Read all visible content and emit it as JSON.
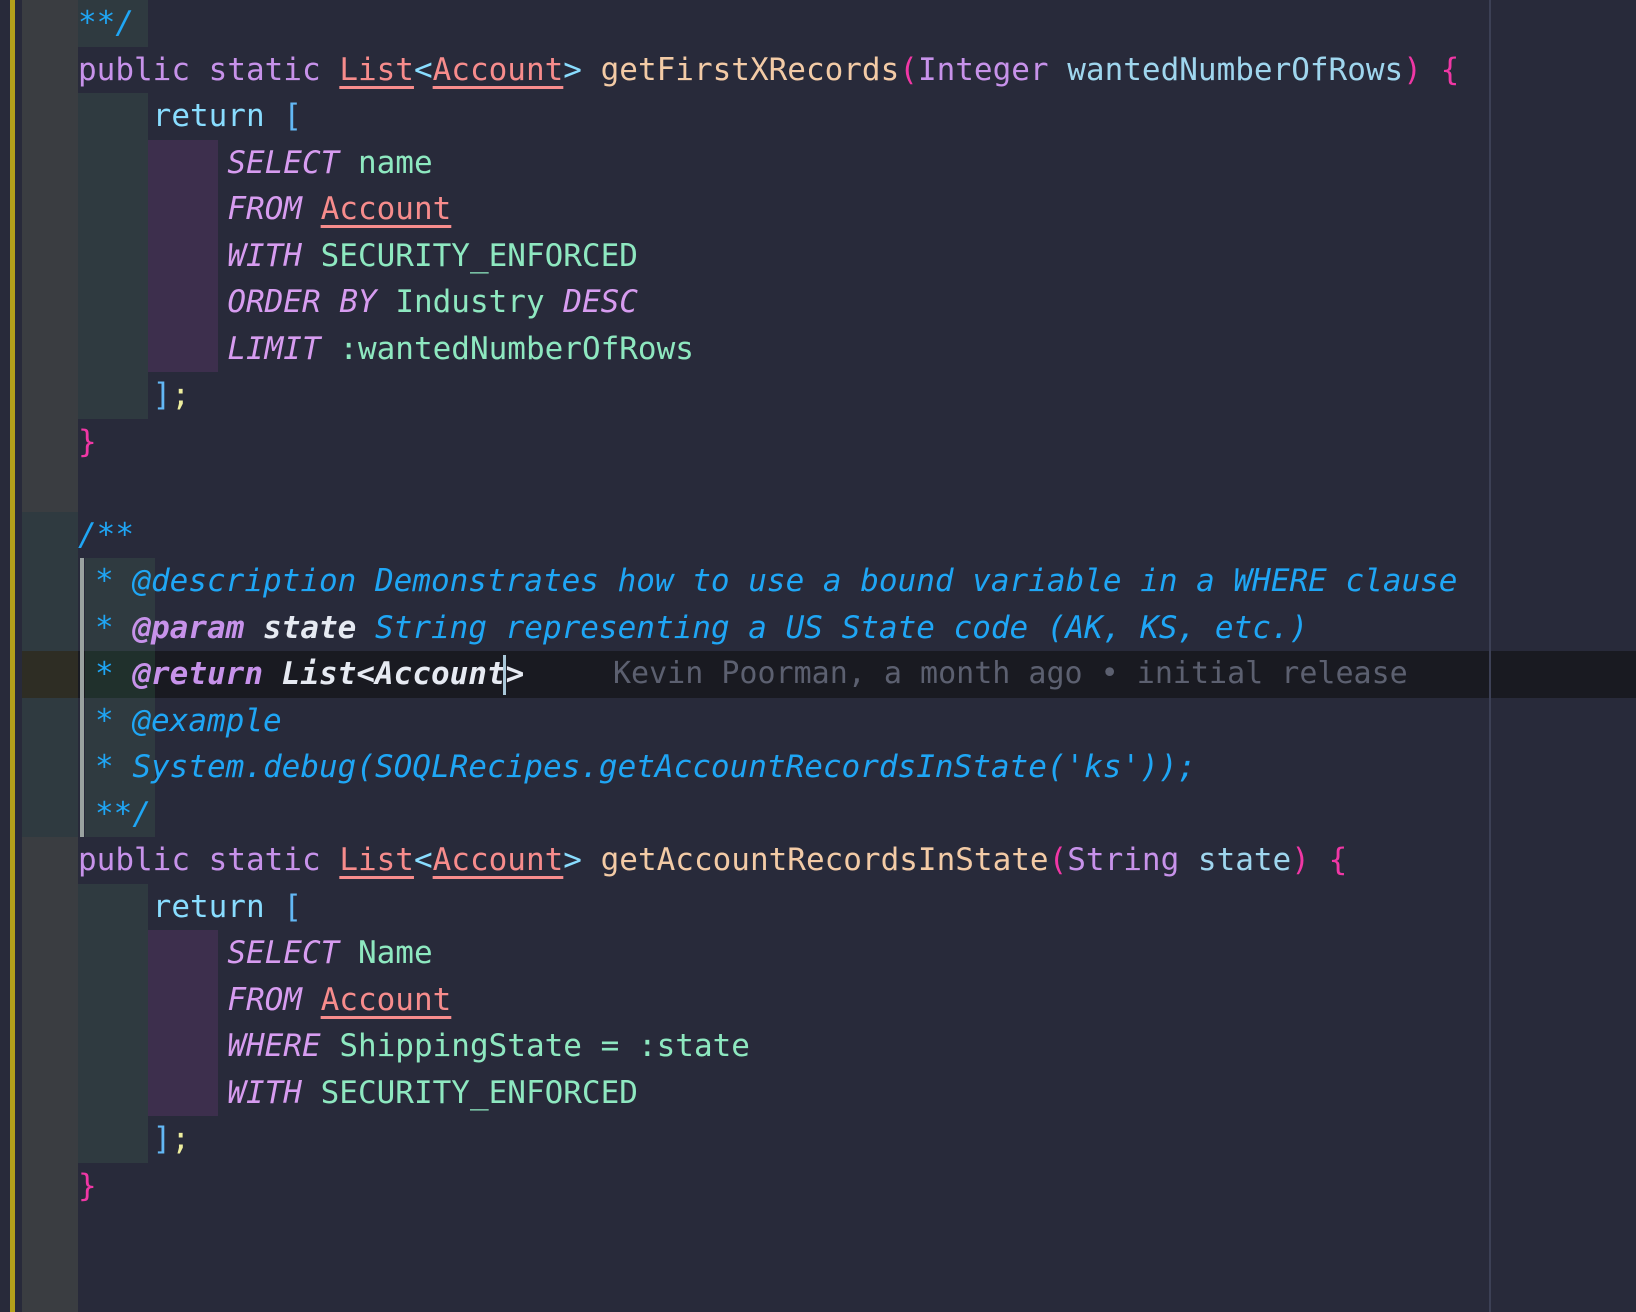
{
  "editor": {
    "language": "apex",
    "font_size_px": 31,
    "line_height_px": 46.5,
    "colors": {
      "background": "#282a3a",
      "gutter": "#3a3d41",
      "edge_accent": "#b3a01b",
      "active_line": "#191a21",
      "ruler": "#3c4055",
      "indent_guide_outer": "#2f3a40",
      "indent_guide_soql": "#3d2f4d",
      "comment_bar": "#9aa2a0",
      "caret": "#a8c7d8",
      "blame_text": "#5c6070",
      "comment": "#1fa6f5",
      "keyword": "#c792ea",
      "type": "#f78c8c",
      "function": "#f3cba6",
      "paren": "#f037a5",
      "bracket": "#63b8f5",
      "parameter": "#9fd6ee",
      "soql_keyword": "#d79cf0",
      "field": "#8ee8c0",
      "semicolon": "#eeee9e",
      "docstring_text": "#e6eaf2"
    }
  },
  "blame": {
    "author": "Kevin Poorman",
    "when": "a month ago",
    "separator": "•",
    "message": "initial release",
    "full_text": "Kevin Poorman, a month ago • initial release"
  },
  "code": {
    "lines": [
      {
        "id": "l01",
        "text": "    **/"
      },
      {
        "id": "l02",
        "text": "public static List<Account> getFirstXRecords(Integer wantedNumberOfRows) {"
      },
      {
        "id": "l03",
        "text": "    return ["
      },
      {
        "id": "l04",
        "text": "        SELECT name"
      },
      {
        "id": "l05",
        "text": "        FROM Account"
      },
      {
        "id": "l06",
        "text": "        WITH SECURITY_ENFORCED"
      },
      {
        "id": "l07",
        "text": "        ORDER BY Industry DESC"
      },
      {
        "id": "l08",
        "text": "        LIMIT :wantedNumberOfRows"
      },
      {
        "id": "l09",
        "text": "    ];"
      },
      {
        "id": "l10",
        "text": "}"
      },
      {
        "id": "l11",
        "text": ""
      },
      {
        "id": "l12",
        "text": "/**"
      },
      {
        "id": "l13",
        "text": " * @description Demonstrates how to use a bound variable in a WHERE clause"
      },
      {
        "id": "l14",
        "text": " * @param state String representing a US State code (AK, KS, etc.)"
      },
      {
        "id": "l15",
        "text": " * @return List<Account>"
      },
      {
        "id": "l16",
        "text": " * @example"
      },
      {
        "id": "l17",
        "text": " * System.debug(SOQLRecipes.getAccountRecordsInState('ks'));"
      },
      {
        "id": "l18",
        "text": " **/"
      },
      {
        "id": "l19",
        "text": "public static List<Account> getAccountRecordsInState(String state) {"
      },
      {
        "id": "l20",
        "text": "    return ["
      },
      {
        "id": "l21",
        "text": "        SELECT Name"
      },
      {
        "id": "l22",
        "text": "        FROM Account"
      },
      {
        "id": "l23",
        "text": "        WHERE ShippingState = :state"
      },
      {
        "id": "l24",
        "text": "        WITH SECURITY_ENFORCED"
      },
      {
        "id": "l25",
        "text": "    ];"
      },
      {
        "id": "l26",
        "text": "}"
      }
    ],
    "tokens": {
      "doc_close": "**/",
      "doc_open": "/**",
      "kw_public": "public",
      "kw_static": "static",
      "type_list": "List",
      "type_account": "Account",
      "angle_open": "<",
      "angle_close": ">",
      "fn_get_first_x_records": "getFirstXRecords",
      "fn_get_account_records_in_state": "getAccountRecordsInState",
      "type_integer": "Integer",
      "type_string": "String",
      "param_wanted_number_of_rows": "wantedNumberOfRows",
      "param_state": "state",
      "kw_return": "return",
      "soql_select": "SELECT",
      "soql_from": "FROM",
      "soql_with": "WITH",
      "soql_where": "WHERE",
      "soql_order": "ORDER",
      "soql_by": "BY",
      "soql_desc": "DESC",
      "soql_limit": "LIMIT",
      "field_name_lower": "name",
      "field_name_upper": "Name",
      "field_industry": "Industry",
      "field_shipping_state": "ShippingState",
      "field_security_enforced": "SECURITY_ENFORCED",
      "bind_wanted_number_of_rows": ":wantedNumberOfRows",
      "bind_state": ":state",
      "op_equals": "=",
      "doc_description_tag": "@description",
      "doc_description_text": "Demonstrates how to use a bound variable in a WHERE clause",
      "doc_param_tag": "@param",
      "doc_param_name": "state",
      "doc_param_text": "String representing a US State code (AK, KS, etc.)",
      "doc_return_tag": "@return",
      "doc_return_type": "List<Account>",
      "doc_example_tag": "@example",
      "doc_example_code": "System.debug(SOQLRecipes.getAccountRecordsInState('ks'));",
      "doc_star": "*",
      "paren_open": "(",
      "paren_close": ")",
      "brace_open": "{",
      "brace_close": "}",
      "bracket_open": "[",
      "bracket_close": "]",
      "semicolon": ";"
    }
  }
}
